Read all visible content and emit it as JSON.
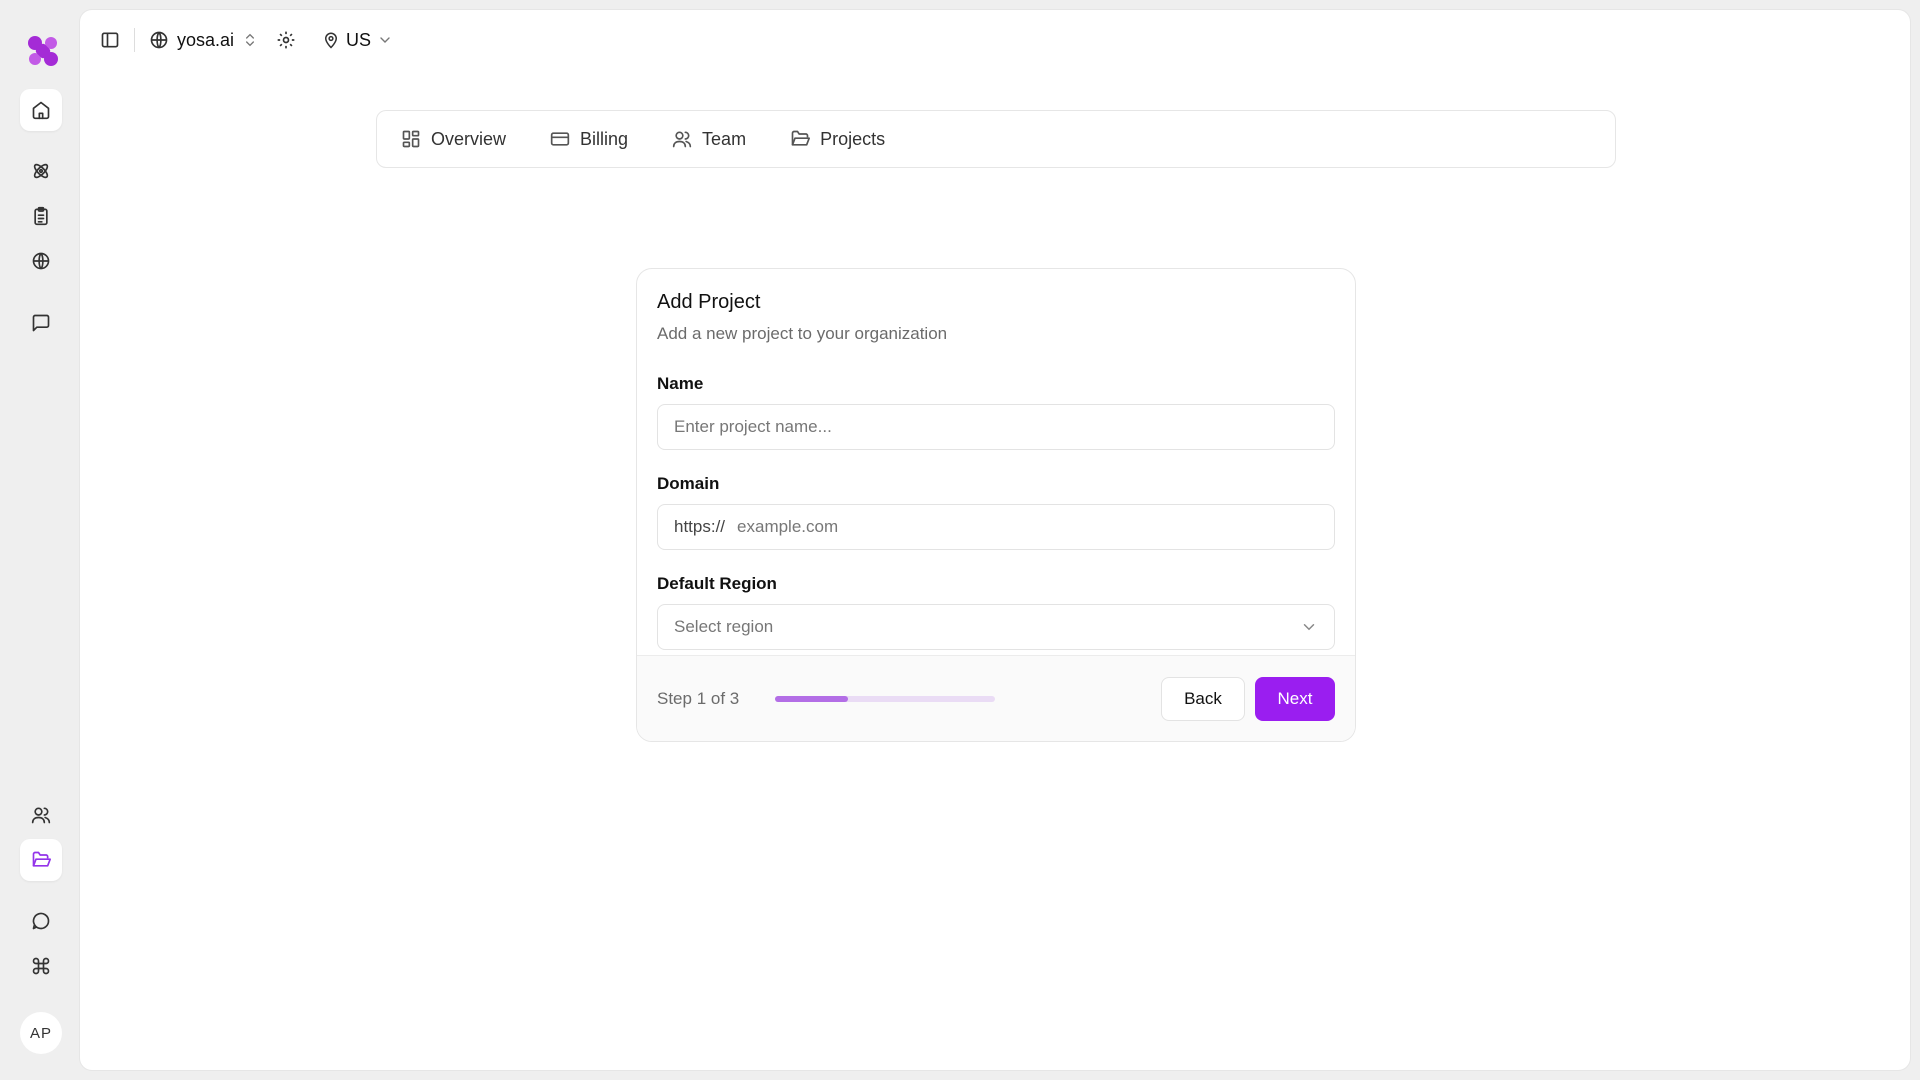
{
  "colors": {
    "accent": "#9a1ef0",
    "progress_track": "#eadcf5",
    "progress_fill": "#b36ee6",
    "logo": "#a42bd6"
  },
  "rail": {
    "top_icons": [
      "home-icon",
      "atom-icon",
      "clipboard-icon",
      "globe-icon",
      "message-square-icon"
    ],
    "bottom_icons": [
      "users-icon",
      "folder-open-icon",
      "message-circle-icon",
      "command-icon"
    ],
    "avatar_initials": "AP"
  },
  "topbar": {
    "org_name": "yosa.ai",
    "region": "US"
  },
  "tabs": [
    {
      "label": "Overview",
      "icon": "layout-grid-icon"
    },
    {
      "label": "Billing",
      "icon": "credit-card-icon"
    },
    {
      "label": "Team",
      "icon": "users-icon"
    },
    {
      "label": "Projects",
      "icon": "folder-icon"
    }
  ],
  "form": {
    "title": "Add Project",
    "subtitle": "Add a new project to your organization",
    "name_label": "Name",
    "name_placeholder": "Enter project name...",
    "domain_label": "Domain",
    "domain_prefix": "https://",
    "domain_placeholder": "example.com",
    "region_label": "Default Region",
    "region_placeholder": "Select region"
  },
  "footer": {
    "step_text": "Step 1 of 3",
    "progress": 0.33,
    "back_label": "Back",
    "next_label": "Next"
  }
}
